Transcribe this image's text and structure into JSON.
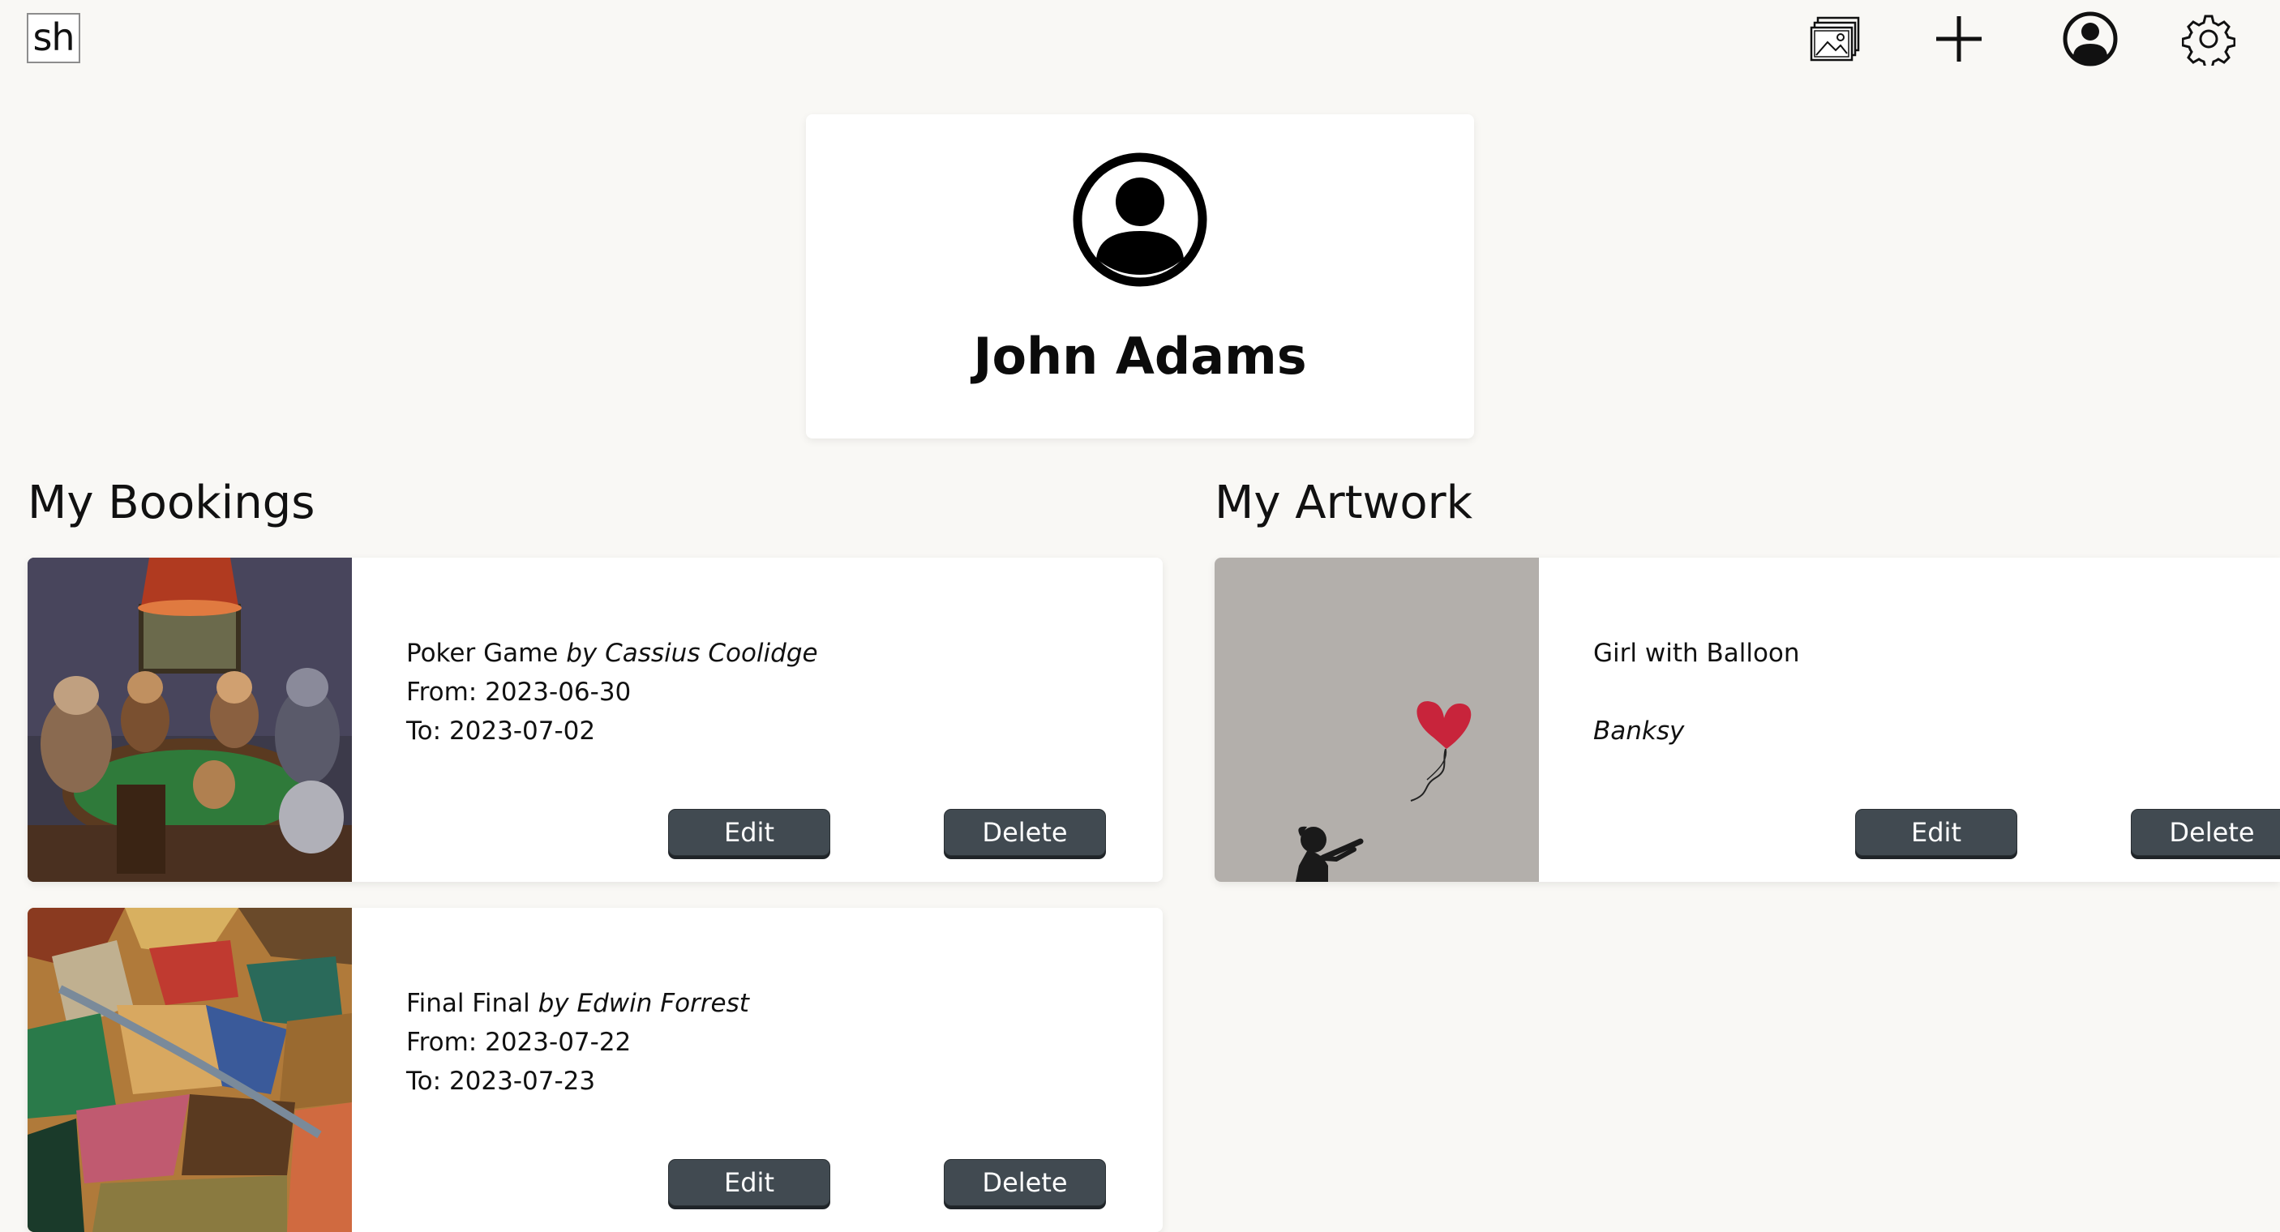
{
  "header": {
    "logo_text": "sh",
    "icons": [
      "gallery-icon",
      "plus-icon",
      "profile-icon",
      "gear-icon"
    ]
  },
  "profile": {
    "name": "John Adams",
    "avatar_icon": "user-circle-icon"
  },
  "bookings": {
    "title": "My Bookings",
    "items": [
      {
        "title": "Poker Game",
        "by_label": "by",
        "artist": "Cassius Coolidge",
        "from_label": "From:",
        "from_date": "2023-06-30",
        "to_label": "To:",
        "to_date": "2023-07-02",
        "edit_label": "Edit",
        "delete_label": "Delete"
      },
      {
        "title": "Final Final",
        "by_label": "by",
        "artist": "Edwin Forrest",
        "from_label": "From:",
        "from_date": "2023-07-22",
        "to_label": "To:",
        "to_date": "2023-07-23",
        "edit_label": "Edit",
        "delete_label": "Delete"
      }
    ]
  },
  "artwork": {
    "title": "My Artwork",
    "items": [
      {
        "title": "Girl with Balloon",
        "artist": "Banksy",
        "edit_label": "Edit",
        "delete_label": "Delete"
      }
    ]
  },
  "colors": {
    "background": "#f9f8f5",
    "button": "#414a51",
    "balloon": "#c8243b"
  }
}
